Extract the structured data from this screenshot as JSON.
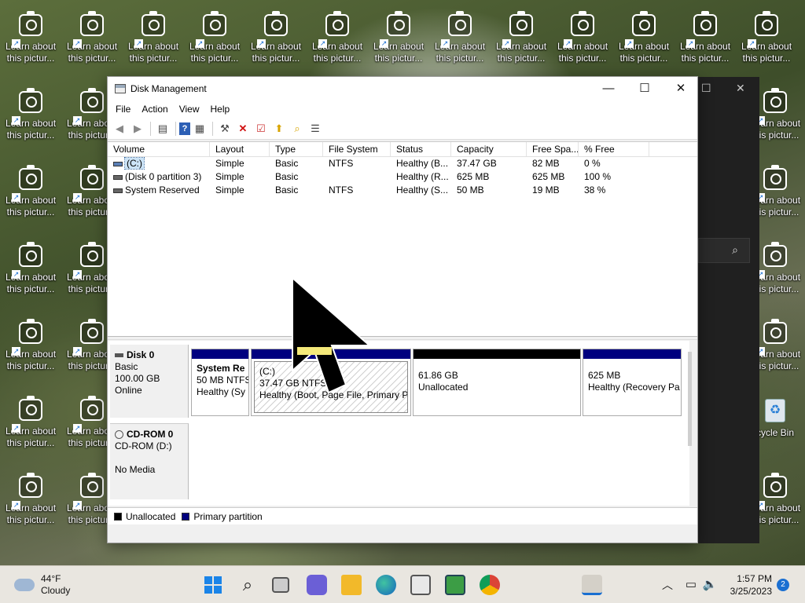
{
  "desktop": {
    "icon_label_line1": "Learn about",
    "icon_label_line2": "this pictur...",
    "recycle_label": "cycle Bin"
  },
  "window": {
    "title": "Disk Management",
    "controls": {
      "minimize": "—",
      "maximize": "☐",
      "close": "✕"
    }
  },
  "menu": [
    "File",
    "Action",
    "View",
    "Help"
  ],
  "volume_list": {
    "columns": [
      "Volume",
      "Layout",
      "Type",
      "File System",
      "Status",
      "Capacity",
      "Free Spa...",
      "% Free"
    ],
    "rows": [
      [
        "(C:)",
        "Simple",
        "Basic",
        "NTFS",
        "Healthy (B...",
        "37.47 GB",
        "82 MB",
        "0 %"
      ],
      [
        "(Disk 0 partition 3)",
        "Simple",
        "Basic",
        "",
        "Healthy (R...",
        "625 MB",
        "625 MB",
        "100 %"
      ],
      [
        "System Reserved",
        "Simple",
        "Basic",
        "NTFS",
        "Healthy (S...",
        "50 MB",
        "19 MB",
        "38 %"
      ]
    ]
  },
  "disks": [
    {
      "name": "Disk 0",
      "type": "Basic",
      "size": "100.00 GB",
      "state": "Online",
      "partitions": [
        {
          "name": "System Re",
          "line2": "50 MB NTFS",
          "line3": "Healthy (Sy"
        },
        {
          "name": "(C:)",
          "line2": "37.47 GB NTFS",
          "line3": "Healthy (Boot, Page File, Primary Pa"
        },
        {
          "name": "",
          "line2": "61.86 GB",
          "line3": "Unallocated"
        },
        {
          "name": "",
          "line2": "625 MB",
          "line3": "Healthy (Recovery Pa"
        }
      ]
    },
    {
      "name": "CD-ROM 0",
      "type": "CD-ROM (D:)",
      "state": "No Media"
    }
  ],
  "legend": [
    {
      "label": "Unallocated",
      "color": "#000000"
    },
    {
      "label": "Primary partition",
      "color": "#00007f"
    }
  ],
  "taskbar": {
    "weather_temp": "44°F",
    "weather_desc": "Cloudy",
    "time": "1:57 PM",
    "date": "3/25/2023",
    "notification_count": "2"
  }
}
